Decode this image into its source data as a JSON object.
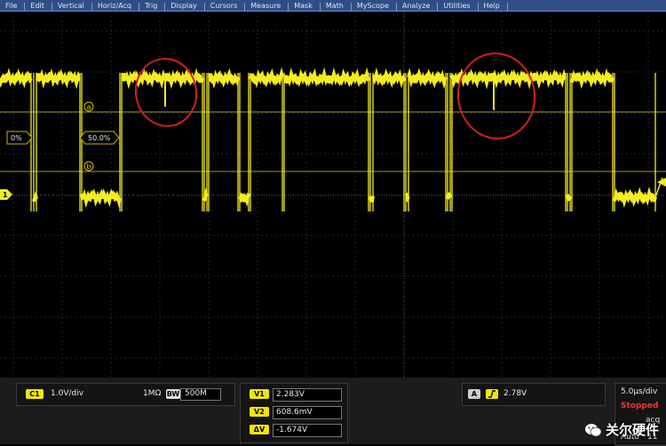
{
  "menu": [
    "File",
    "Edit",
    "Vertical",
    "Horiz/Acq",
    "Trig",
    "Display",
    "Cursors",
    "Measure",
    "Mask",
    "Math",
    "MyScope",
    "Analyze",
    "Utilities",
    "Help"
  ],
  "screen": {
    "cursor_a": "a",
    "cursor_b": "b",
    "level_left": "0%",
    "level_mid": "50.0%",
    "ch1_marker": "1"
  },
  "bottom": {
    "ch_chip": "C1",
    "volts_div": "1.0V/div",
    "impedance": "1MΩ",
    "bw_chip": "BW",
    "bw_value": "500M",
    "v1_chip": "V1",
    "v1_value": "2.283V",
    "v2_chip": "V2",
    "v2_value": "608.6mV",
    "dv_chip": "ΔV",
    "dv_value": "-1.674V",
    "trig_chip": "A",
    "trig_level": "2.78V",
    "timebase": "5.0μs/div",
    "status": "Stopped",
    "acq": "acq",
    "auto": "Auto",
    "auto_tail": "11"
  },
  "watermark": "关尔硬件",
  "colors": {
    "trace": "#f5ec20",
    "cursor": "#9a9a2a",
    "annotation": "#d21e1e",
    "menu_bg": "#2e4f86"
  }
}
